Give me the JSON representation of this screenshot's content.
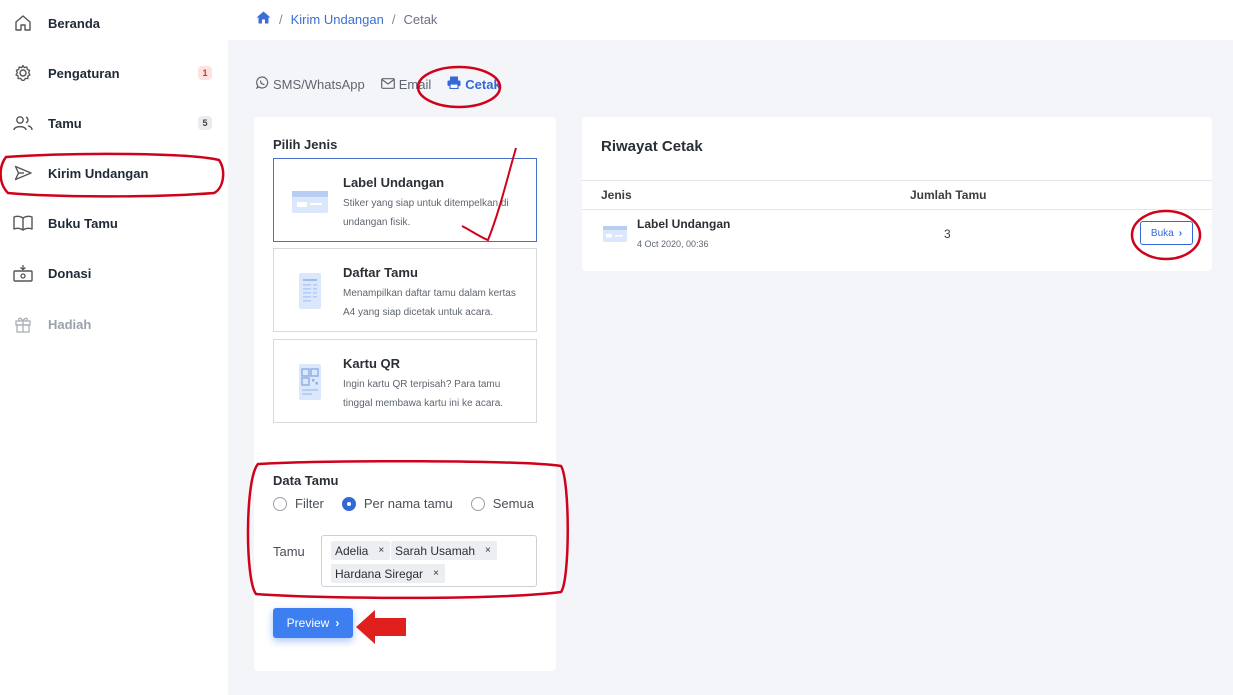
{
  "sidebar": {
    "items": [
      {
        "label": "Beranda",
        "icon": "home-icon"
      },
      {
        "label": "Pengaturan",
        "icon": "gear-icon",
        "badge": "1"
      },
      {
        "label": "Tamu",
        "icon": "users-icon",
        "badge": "5"
      },
      {
        "label": "Kirim Undangan",
        "icon": "send-icon"
      },
      {
        "label": "Buku Tamu",
        "icon": "book-icon"
      },
      {
        "label": "Donasi",
        "icon": "donation-icon"
      },
      {
        "label": "Hadiah",
        "icon": "gift-icon",
        "disabled": true
      }
    ]
  },
  "breadcrumb": {
    "home_icon": "home-icon",
    "items": [
      "Kirim Undangan",
      "Cetak"
    ]
  },
  "tabs": [
    {
      "label": "SMS/WhatsApp",
      "icon": "whatsapp-icon"
    },
    {
      "label": "Email",
      "icon": "envelope-icon"
    },
    {
      "label": "Cetak",
      "icon": "printer-icon",
      "active": true
    }
  ],
  "pilih_jenis": {
    "title": "Pilih Jenis",
    "options": [
      {
        "title": "Label Undangan",
        "desc": "Stiker yang siap untuk ditempelkan di undangan fisik.",
        "selected": true
      },
      {
        "title": "Daftar Tamu",
        "desc": "Menampilkan daftar tamu dalam kertas A4 yang siap dicetak untuk acara."
      },
      {
        "title": "Kartu QR",
        "desc": "Ingin kartu QR terpisah? Para tamu tinggal membawa kartu ini ke acara."
      }
    ]
  },
  "data_tamu": {
    "title": "Data Tamu",
    "radios": [
      "Filter",
      "Per nama tamu",
      "Semua"
    ],
    "selected": "Per nama tamu",
    "tamu_label": "Tamu",
    "tags": [
      "Adelia",
      "Sarah Usamah",
      "Hardana Siregar"
    ],
    "remove_glyph": "×"
  },
  "preview_button": {
    "label": "Preview",
    "chevron": "›"
  },
  "riwayat": {
    "title": "Riwayat Cetak",
    "columns": [
      "Jenis",
      "Jumlah Tamu"
    ],
    "rows": [
      {
        "name": "Label Undangan",
        "date": "4 Oct 2020, 00:36",
        "count": "3",
        "action": "Buka"
      }
    ],
    "chevron": "›"
  },
  "colors": {
    "accent": "#3468d6",
    "annotation": "#d0021b"
  }
}
